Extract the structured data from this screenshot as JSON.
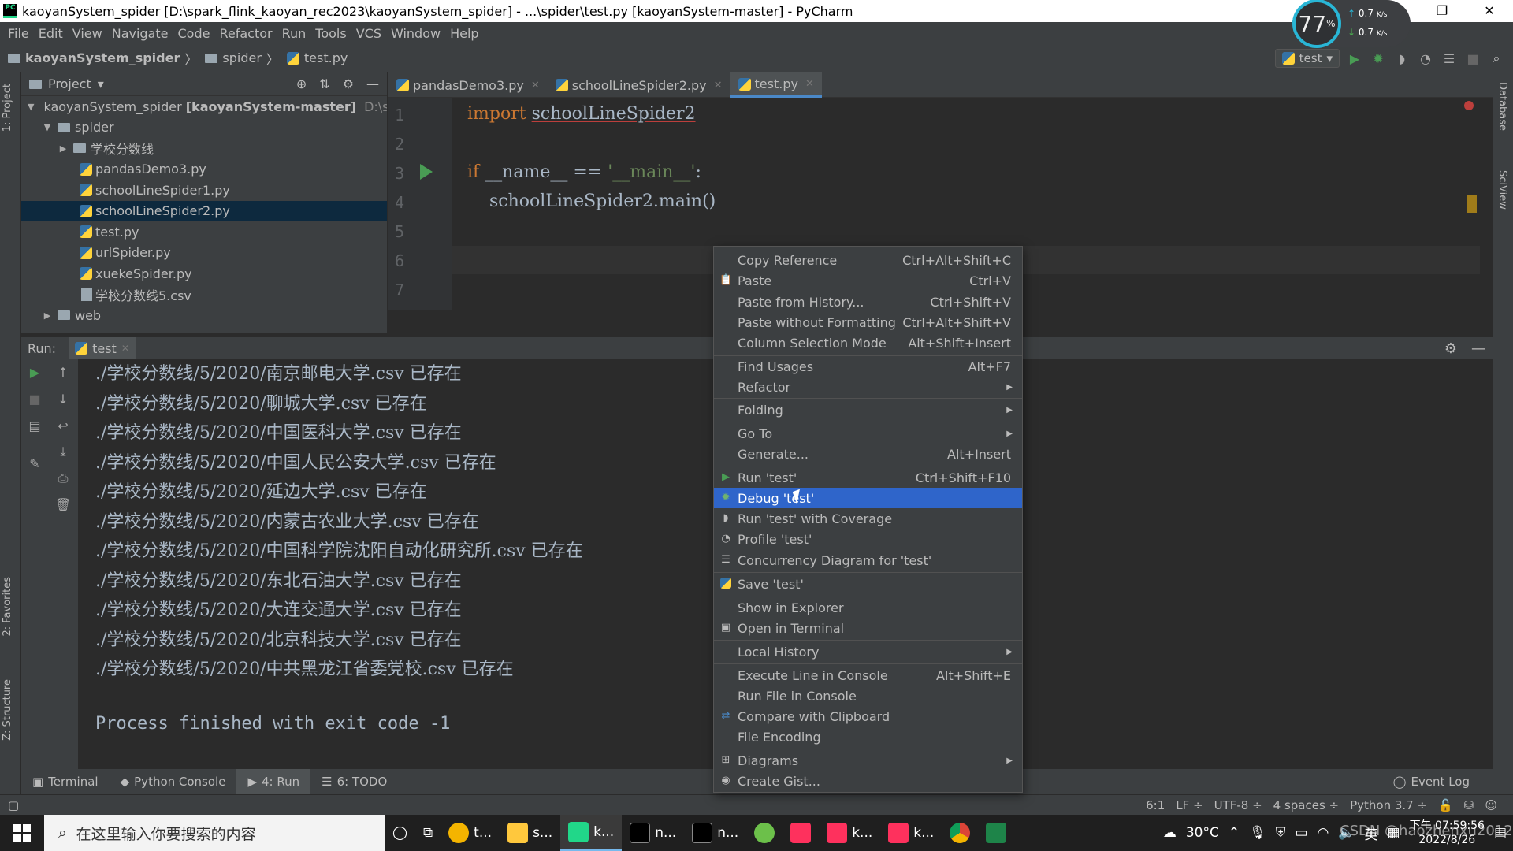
{
  "window": {
    "title": "kaoyanSystem_spider [D:\\spark_flink_kaoyan_rec2023\\kaoyanSystem_spider] - ...\\spider\\test.py [kaoyanSystem-master] - PyCharm",
    "logo_text": "PC"
  },
  "menu": [
    "File",
    "Edit",
    "View",
    "Navigate",
    "Code",
    "Refactor",
    "Run",
    "Tools",
    "VCS",
    "Window",
    "Help"
  ],
  "breadcrumb": [
    "kaoyanSystem_spider",
    "spider",
    "test.py"
  ],
  "run_config": "test",
  "net_widget": {
    "percent": "77",
    "unit": "%",
    "up": "0.7",
    "down": "0.7",
    "rate_unit": "K/s"
  },
  "project": {
    "header": "Project",
    "tree": [
      {
        "label": "kaoyanSystem_spider",
        "bold_suffix": "[kaoyanSystem-master]",
        "tail": "D:\\spark_",
        "type": "folder",
        "arrow": "▼"
      },
      {
        "label": "spider",
        "type": "folder",
        "arrow": "▼"
      },
      {
        "label": "学校分数线",
        "type": "folder",
        "arrow": "▶"
      },
      {
        "label": "pandasDemo3.py",
        "type": "py"
      },
      {
        "label": "schoolLineSpider1.py",
        "type": "py"
      },
      {
        "label": "schoolLineSpider2.py",
        "type": "py",
        "selected": true
      },
      {
        "label": "test.py",
        "type": "py"
      },
      {
        "label": "urlSpider.py",
        "type": "py"
      },
      {
        "label": "xuekeSpider.py",
        "type": "py"
      },
      {
        "label": "学校分数线5.csv",
        "type": "csv"
      },
      {
        "label": "web",
        "type": "folder",
        "arrow": "▶"
      }
    ]
  },
  "tabs": [
    {
      "label": "pandasDemo3.py",
      "active": false
    },
    {
      "label": "schoolLineSpider2.py",
      "active": false
    },
    {
      "label": "test.py",
      "active": true
    }
  ],
  "editor": {
    "line_numbers": [
      "1",
      "2",
      "3",
      "4",
      "5",
      "6",
      "7"
    ],
    "code": {
      "l1_kw": "import",
      "l1_mod": "schoolLineSpider2",
      "l3_kw": "if",
      "l3_rest": " __name__ == ",
      "l3_str": "'__main__'",
      "l3_colon": ":",
      "l4": "    schoolLineSpider2.main()"
    }
  },
  "run_panel": {
    "label": "Run:",
    "tab": "test",
    "output": [
      "./学校分数线/5/2020/南京邮电大学.csv 已存在",
      "./学校分数线/5/2020/聊城大学.csv 已存在",
      "./学校分数线/5/2020/中国医科大学.csv 已存在",
      "./学校分数线/5/2020/中国人民公安大学.csv 已存在",
      "./学校分数线/5/2020/延边大学.csv 已存在",
      "./学校分数线/5/2020/内蒙古农业大学.csv 已存在",
      "./学校分数线/5/2020/中国科学院沈阳自动化研究所.csv 已存在",
      "./学校分数线/5/2020/东北石油大学.csv 已存在",
      "./学校分数线/5/2020/大连交通大学.csv 已存在",
      "./学校分数线/5/2020/北京科技大学.csv 已存在",
      "./学校分数线/5/2020/中共黑龙江省委党校.csv 已存在"
    ],
    "exit_message": "Process finished with exit code -1"
  },
  "context_menu": [
    {
      "label": "Copy Reference",
      "shortcut": "Ctrl+Alt+Shift+C"
    },
    {
      "label": "Paste",
      "shortcut": "Ctrl+V",
      "icon": "paste-icon"
    },
    {
      "label": "Paste from History...",
      "shortcut": "Ctrl+Shift+V"
    },
    {
      "label": "Paste without Formatting",
      "shortcut": "Ctrl+Alt+Shift+V"
    },
    {
      "label": "Column Selection Mode",
      "shortcut": "Alt+Shift+Insert"
    },
    {
      "label": "Find Usages",
      "shortcut": "Alt+F7"
    },
    {
      "label": "Refactor",
      "submenu": true
    },
    {
      "label": "Folding",
      "submenu": true
    },
    {
      "label": "Go To",
      "submenu": true
    },
    {
      "label": "Generate...",
      "shortcut": "Alt+Insert"
    },
    {
      "label": "Run 'test'",
      "shortcut": "Ctrl+Shift+F10",
      "icon": "run-icon"
    },
    {
      "label": "Debug 'test'",
      "highlighted": true,
      "icon": "debug-icon"
    },
    {
      "label": "Run 'test' with Coverage",
      "icon": "coverage-icon"
    },
    {
      "label": "Profile 'test'",
      "icon": "profile-icon"
    },
    {
      "label": "Concurrency Diagram for 'test'",
      "icon": "concurrency-icon"
    },
    {
      "label": "Save 'test'",
      "icon": "python-icon"
    },
    {
      "label": "Show in Explorer"
    },
    {
      "label": "Open in Terminal",
      "icon": "terminal-icon"
    },
    {
      "label": "Local History",
      "submenu": true
    },
    {
      "label": "Execute Line in Console",
      "shortcut": "Alt+Shift+E"
    },
    {
      "label": "Run File in Console"
    },
    {
      "label": "Compare with Clipboard",
      "icon": "compare-icon"
    },
    {
      "label": "File Encoding"
    },
    {
      "label": "Diagrams",
      "submenu": true,
      "icon": "diagram-icon"
    },
    {
      "label": "Create Gist...",
      "icon": "github-icon"
    }
  ],
  "bottom_tabs": [
    "Terminal",
    "Python Console",
    "4: Run",
    "6: TODO"
  ],
  "event_log": "Event Log",
  "left_strip": {
    "project": "1: Project",
    "favorites": "2: Favorites",
    "structure": "Z: Structure"
  },
  "right_strip": {
    "database": "Database",
    "sciview": "SciView"
  },
  "status": {
    "pos": "6:1",
    "lf": "LF ÷",
    "enc": "UTF-8 ÷",
    "indent": "4 spaces ÷",
    "interp": "Python 3.7 ÷"
  },
  "taskbar": {
    "search_placeholder": "在这里输入你要搜索的内容",
    "apps": [
      "t...",
      "s...",
      "k...",
      "n...",
      "n...",
      "",
      "",
      "k...",
      "k...",
      "",
      ""
    ],
    "weather": "30°C",
    "lang": "英",
    "time": "下午 07:59:56",
    "date": "2022/8/26",
    "watermark": "CSDN @haozhenxu2012"
  }
}
